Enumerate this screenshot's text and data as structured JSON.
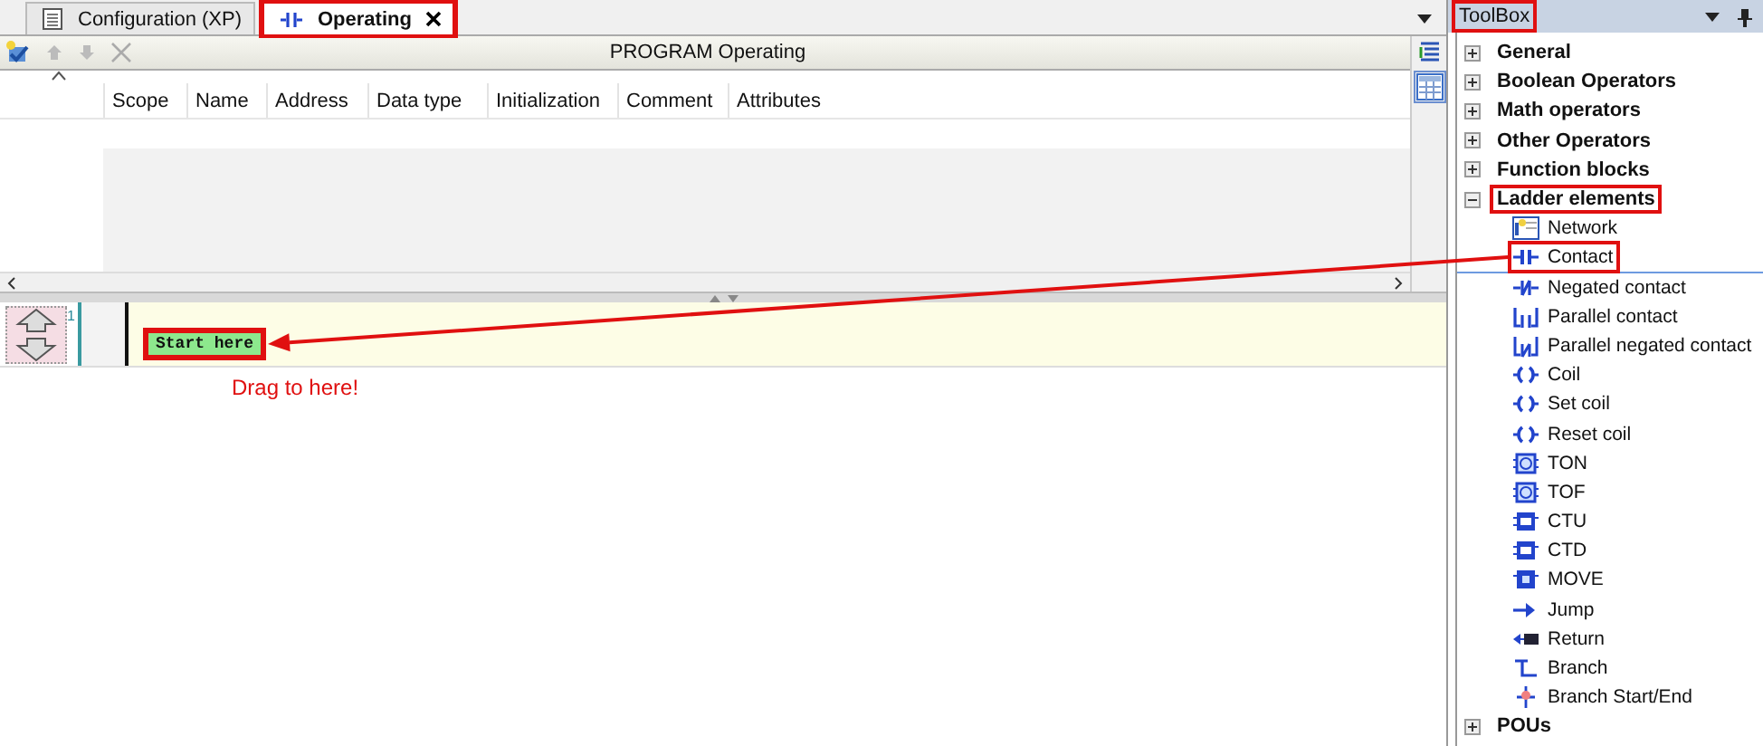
{
  "tabs": [
    {
      "label": "Configuration (XP)",
      "kind": "config",
      "selected": false,
      "annotated": false,
      "closable": false
    },
    {
      "label": "Operating",
      "kind": "program",
      "selected": true,
      "annotated": true,
      "closable": true
    }
  ],
  "editor": {
    "title": "PROGRAM Operating",
    "columns": [
      "Scope",
      "Name",
      "Address",
      "Data type",
      "Initialization",
      "Comment",
      "Attributes"
    ]
  },
  "ladder": {
    "networks": [
      {
        "number": "1",
        "placeholder": "Start here",
        "annotated": true
      }
    ],
    "hint": "Drag to here!"
  },
  "toolbox": {
    "title": "ToolBox",
    "annotated": true,
    "groups": [
      {
        "label": "General",
        "expanded": false,
        "annotated": false
      },
      {
        "label": "Boolean Operators",
        "expanded": false,
        "annotated": false
      },
      {
        "label": "Math operators",
        "expanded": false,
        "annotated": false
      },
      {
        "label": "Other Operators",
        "expanded": false,
        "annotated": false
      },
      {
        "label": "Function blocks",
        "expanded": false,
        "annotated": false
      },
      {
        "label": "Ladder elements",
        "expanded": true,
        "annotated": true,
        "children": [
          {
            "label": "Network",
            "kind": "network",
            "selected": false,
            "annotated": false
          },
          {
            "label": "Contact",
            "kind": "contact",
            "selected": true,
            "annotated": true
          },
          {
            "label": "Negated contact",
            "kind": "negcontact",
            "selected": false,
            "annotated": false
          },
          {
            "label": "Parallel contact",
            "kind": "parcontact",
            "selected": false,
            "annotated": false
          },
          {
            "label": "Parallel negated contact",
            "kind": "parnegcontact",
            "selected": false,
            "annotated": false
          },
          {
            "label": "Coil",
            "kind": "coil",
            "selected": false,
            "annotated": false
          },
          {
            "label": "Set coil",
            "kind": "coil",
            "selected": false,
            "annotated": false
          },
          {
            "label": "Reset coil",
            "kind": "coil",
            "selected": false,
            "annotated": false
          },
          {
            "label": "TON",
            "kind": "timer",
            "selected": false,
            "annotated": false
          },
          {
            "label": "TOF",
            "kind": "timer",
            "selected": false,
            "annotated": false
          },
          {
            "label": "CTU",
            "kind": "counter",
            "selected": false,
            "annotated": false
          },
          {
            "label": "CTD",
            "kind": "counter",
            "selected": false,
            "annotated": false
          },
          {
            "label": "MOVE",
            "kind": "block",
            "selected": false,
            "annotated": false
          },
          {
            "label": "Jump",
            "kind": "jump",
            "selected": false,
            "annotated": false
          },
          {
            "label": "Return",
            "kind": "return",
            "selected": false,
            "annotated": false
          },
          {
            "label": "Branch",
            "kind": "branch",
            "selected": false,
            "annotated": false
          },
          {
            "label": "Branch Start/End",
            "kind": "branchend",
            "selected": false,
            "annotated": false
          }
        ]
      },
      {
        "label": "POUs",
        "expanded": false,
        "annotated": false
      }
    ]
  },
  "annotation": {
    "arrow": true
  }
}
